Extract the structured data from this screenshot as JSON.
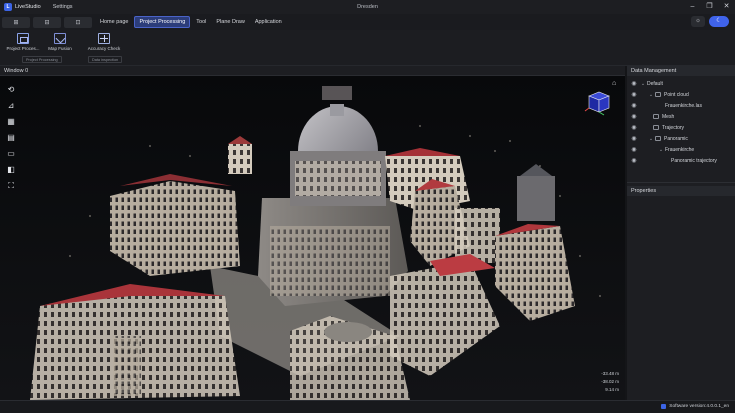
{
  "app": {
    "name": "LiveStudio",
    "logo_letter": "L",
    "settings": "Settings",
    "window_title": "Dresden"
  },
  "window_controls": {
    "minimize": "–",
    "restore": "❐",
    "close": "✕"
  },
  "quick_buttons": [
    "⊞",
    "⊟",
    "⊡"
  ],
  "tabs": [
    {
      "label": "Home page",
      "active": false
    },
    {
      "label": "Project Processing",
      "active": true
    },
    {
      "label": "Tool",
      "active": false
    },
    {
      "label": "Plane Draw",
      "active": false
    },
    {
      "label": "Application",
      "active": false
    }
  ],
  "theme": {
    "light_icon": "☼",
    "dark_icon": "☾"
  },
  "ribbon": {
    "items": [
      {
        "label": "Project Proces...",
        "icon": "process-icon"
      },
      {
        "label": "Map Fusion",
        "icon": "fusion-icon"
      },
      {
        "label": "Accuracy Check",
        "icon": "check-icon"
      }
    ],
    "groups": [
      "Project Processing",
      "Data inspection"
    ]
  },
  "viewport": {
    "title": "Window 0",
    "home_icon": "⌂",
    "tools": [
      "⟲",
      "⊿",
      "▦",
      "▤",
      "▭",
      "◧",
      "⛶"
    ],
    "coordinates": [
      "-33.48 m",
      "-38.02 m",
      "9.14 m"
    ]
  },
  "data_management": {
    "title": "Data Management",
    "tree": [
      {
        "label": "Default",
        "level": 0,
        "chevron": true
      },
      {
        "label": "Point cloud",
        "level": 1,
        "chevron": true
      },
      {
        "label": "Frauenkirche.las",
        "level": 3,
        "chevron": false
      },
      {
        "label": "Mesh",
        "level": 2,
        "chevron": false
      },
      {
        "label": "Trajectory",
        "level": 2,
        "chevron": false
      },
      {
        "label": "Panoramic",
        "level": 1,
        "chevron": true
      },
      {
        "label": "Frauenkirche",
        "level": 2,
        "chevron": true
      },
      {
        "label": "Panoramic trajectory",
        "level": 3,
        "chevron": false
      }
    ]
  },
  "properties": {
    "title": "Properties"
  },
  "status": {
    "version": "Software version:4.0.0.1_en"
  },
  "colors": {
    "accent": "#3f63ea",
    "active_tab": "#2c3d7a",
    "panel": "#1d1e22",
    "viewport_bg": "#0c0d10"
  }
}
